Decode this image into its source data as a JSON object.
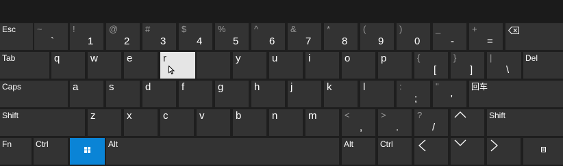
{
  "keyboard": {
    "row1": {
      "esc": "Esc",
      "k1": {
        "main": "1",
        "shift": "!"
      },
      "k2": {
        "main": "2",
        "shift": "@"
      },
      "k3": {
        "main": "3",
        "shift": "#"
      },
      "k4": {
        "main": "4",
        "shift": "$"
      },
      "k5": {
        "main": "5",
        "shift": "%"
      },
      "k6": {
        "main": "6",
        "shift": "^"
      },
      "k7": {
        "main": "7",
        "shift": "&"
      },
      "k8": {
        "main": "8",
        "shift": "*"
      },
      "k9": {
        "main": "9",
        "shift": "("
      },
      "k0": {
        "main": "0",
        "shift": ")"
      },
      "minus": {
        "main": "-",
        "shift": "_"
      },
      "equals": {
        "main": "=",
        "shift": "+"
      },
      "backtick": {
        "main": "`",
        "shift": "~"
      }
    },
    "row2": {
      "tab": "Tab",
      "q": "q",
      "w": "w",
      "e": "e",
      "r": "r",
      "t": "",
      "y": "y",
      "u": "u",
      "i": "i",
      "o": "o",
      "p": "p",
      "lbracket": {
        "main": "[",
        "shift": "{"
      },
      "rbracket": {
        "main": "]",
        "shift": "}"
      },
      "backslash": {
        "main": "\\",
        "shift": "|"
      },
      "del": "Del"
    },
    "row3": {
      "caps": "Caps",
      "a": "a",
      "s": "s",
      "d": "d",
      "f": "f",
      "g": "g",
      "h": "h",
      "j": "j",
      "k": "k",
      "l": "l",
      "semicolon": {
        "main": ";",
        "shift": ":"
      },
      "quote": {
        "main": "'",
        "shift": "\""
      },
      "enter": "回车"
    },
    "row4": {
      "shift_left": "Shift",
      "z": "z",
      "x": "x",
      "c": "c",
      "v": "v",
      "b": "b",
      "n": "n",
      "m": "m",
      "comma": {
        "main": ",",
        "shift": "<"
      },
      "period": {
        "main": ".",
        "shift": ">"
      },
      "slash": {
        "main": "/",
        "shift": "?"
      },
      "shift_right": "Shift"
    },
    "row5": {
      "fn": "Fn",
      "ctrl_left": "Ctrl",
      "alt_left": "Alt",
      "alt_right": "Alt",
      "ctrl_right": "Ctrl"
    },
    "icons": {
      "backspace": "backspace-icon",
      "windows": "windows-logo-icon",
      "up": "arrow-up-icon",
      "left": "arrow-left-icon",
      "down": "arrow-down-icon",
      "right": "arrow-right-icon",
      "menu": "context-menu-icon"
    },
    "colors": {
      "key": "#333333",
      "key_hover": "#e5e5e5",
      "windows_key": "#0a84d6",
      "background": "#1e1e1e",
      "text": "#ffffff"
    }
  }
}
